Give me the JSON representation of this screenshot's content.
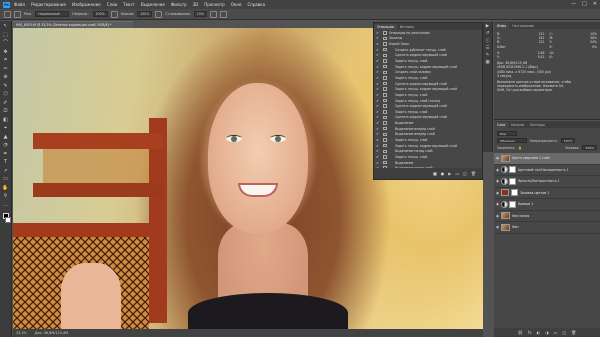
{
  "menubar": {
    "logo": "Ps",
    "items": [
      "Файл",
      "Редактирование",
      "Изображение",
      "Слои",
      "Текст",
      "Выделение",
      "Фильтр",
      "3D",
      "Просмотр",
      "Окно",
      "Справка"
    ],
    "window_controls": [
      "—",
      "□",
      "✕"
    ]
  },
  "options": {
    "mode_label": "Реж.",
    "mode_value": "Нормальный",
    "opacity_label": "Непрозр.:",
    "opacity_value": "100%",
    "flow_label": "Нажим:",
    "flow_value": "100%",
    "smoothing_label": "Сглаживание:",
    "smoothing_value": "10%"
  },
  "document": {
    "tab_title": "IMG_8553.tif @ 33,3% (Зелёная коррекция слой, RGB/8) *",
    "status_zoom": "33,3%",
    "status_doc": "Док: 36,8M/125,4M"
  },
  "history": {
    "tabs": [
      "Операции",
      "История"
    ],
    "rows": [
      {
        "label": "Операции по умолчанию",
        "check": "✔"
      },
      {
        "label": "Экшены",
        "check": "✔"
      },
      {
        "label": "Новый Экшн",
        "check": "✔"
      },
      {
        "label": "Создать дубликат текущ. слой",
        "check": "✔"
      },
      {
        "label": "Сделать корректирующий слой",
        "check": "✔"
      },
      {
        "label": "Задать текущ. слой",
        "check": "✔"
      },
      {
        "label": "Задать текущ. корректирующий слой",
        "check": "✔"
      },
      {
        "label": "Создать слой-заливку",
        "check": "✔"
      },
      {
        "label": "Задать текущ. слой",
        "check": "✔"
      },
      {
        "label": "Сделать корректирующий слой",
        "check": "✔"
      },
      {
        "label": "Задать текущ. корректирующий слой",
        "check": "✔"
      },
      {
        "label": "Задать текущ. слой",
        "check": "✔"
      },
      {
        "label": "Задать текущ. слой (точно)",
        "check": "✔"
      },
      {
        "label": "Сделать корректирующий слой",
        "check": "✔"
      },
      {
        "label": "Задать текущ. слой",
        "check": "✔"
      },
      {
        "label": "Сделать корректирующий слой",
        "check": "✔"
      },
      {
        "label": "Выделение",
        "check": "✔"
      },
      {
        "label": "Выделение вперёд слой",
        "check": "✔"
      },
      {
        "label": "Выделение вперёд слой",
        "check": "✔"
      },
      {
        "label": "Задать текущ. слой",
        "check": "✔"
      },
      {
        "label": "Задать текущ. корректирующий слой",
        "check": "✔"
      },
      {
        "label": "Выделение назад слой",
        "check": "✔"
      },
      {
        "label": "Задать текущ. слой",
        "check": "✔"
      },
      {
        "label": "Выделение",
        "check": "✔"
      },
      {
        "label": "Выделение назад слой",
        "check": "✔"
      },
      {
        "label": "Показать текущ. слой",
        "check": "✔"
      },
      {
        "label": "Выделение слой \"Color fill 1\"",
        "check": "✔"
      },
      {
        "label": "Задать текущ. слой",
        "check": "✔"
      }
    ],
    "selected_index": 26,
    "footer": [
      "■",
      "●",
      "▶",
      "▭",
      "◫",
      "🗑"
    ]
  },
  "info": {
    "tabs": [
      "Инфо",
      "Гистограмма"
    ],
    "left": [
      {
        "k": "R:",
        "v": "212"
      },
      {
        "k": "G:",
        "v": "162"
      },
      {
        "k": "B:",
        "v": "122"
      },
      {
        "k": "8-бит",
        "v": ""
      }
    ],
    "right": [
      {
        "k": "C:",
        "v": "10%"
      },
      {
        "k": "M:",
        "v": "38%"
      },
      {
        "k": "Y:",
        "v": "54%"
      },
      {
        "k": "K:",
        "v": "0%"
      }
    ],
    "coords": [
      {
        "k": "X:",
        "v": "2,46"
      },
      {
        "k": "Y:",
        "v": "9,42"
      },
      {
        "k": "Ш:",
        "v": ""
      },
      {
        "k": "В:",
        "v": ""
      }
    ],
    "doc_lines": [
      "Док: 36,8M/125,4M",
      "sRGB IEC61966-2.1 (8bpc)",
      "4480 пикс. x 6720 пикс. (300 ppi)",
      "3 секунд"
    ],
    "hint_lines": [
      "Выполните щелчок и перетаскивание, чтобы",
      "перекрасить изображение. Нажмите Alt,",
      "Shift, Ctrl для выбора параметров."
    ]
  },
  "layers": {
    "tabs": [
      "Слои",
      "Каналы",
      "Контуры"
    ],
    "kind_label": "Вид",
    "blend_value": "Обычные",
    "opacity_label": "Непрозрачность:",
    "opacity_value": "100%",
    "lock_label": "Закрепить:",
    "fill_label": "Заливка:",
    "fill_value": "100%",
    "items": [
      {
        "name": "Цвета оверлеев 1 слой",
        "type": "photo",
        "selected": true
      },
      {
        "name": "Цветовой тон/Насыщенность 1",
        "type": "adjust",
        "selected": false
      },
      {
        "name": "Яркость/Контрастность 1",
        "type": "adjust",
        "selected": false
      },
      {
        "name": "Заливка цветом 1",
        "type": "color",
        "color": "#8f2e1c",
        "selected": false
      },
      {
        "name": "Кривые 1",
        "type": "adjust",
        "selected": false
      },
      {
        "name": "Фон копия",
        "type": "photo",
        "selected": false
      },
      {
        "name": "Фон",
        "type": "photo",
        "selected": false
      }
    ],
    "footer": [
      "⛓",
      "fx",
      "◐",
      "◑",
      "▭",
      "◫",
      "🗑"
    ]
  },
  "tools": [
    "↖",
    "⬚",
    "⌒",
    "✥",
    "⌗",
    "✂",
    "⊕",
    "✎",
    "⬡",
    "✐",
    "⎚",
    "◧",
    "⌖",
    "▲",
    "◔",
    "✒",
    "T",
    "↗",
    "▭",
    "✋",
    "⚲",
    "…"
  ]
}
